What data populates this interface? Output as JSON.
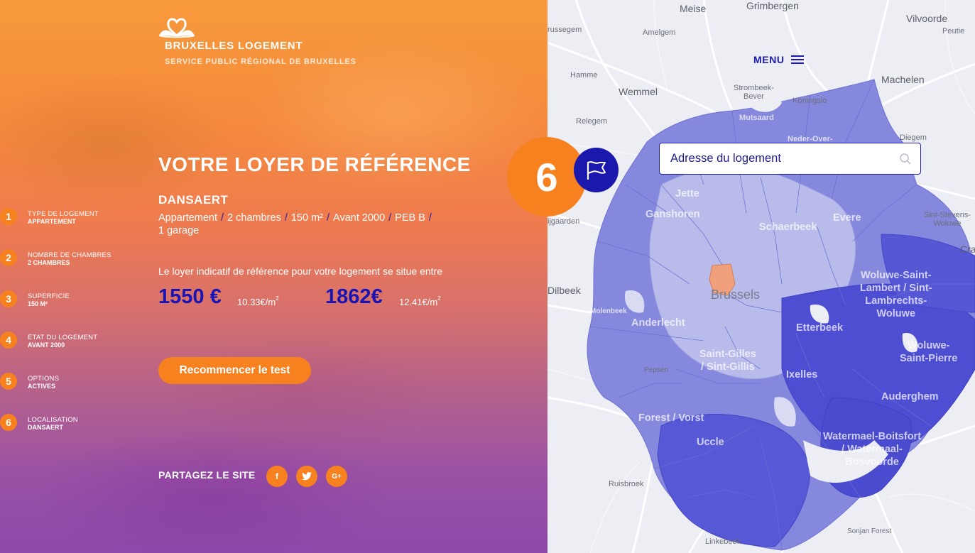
{
  "brand": {
    "title": "BRUXELLES LOGEMENT",
    "subtitle": "SERVICE PUBLIC RÉGIONAL DE BRUXELLES"
  },
  "steps": [
    {
      "num": "1",
      "label": "TYPE DE LOGEMENT",
      "value": "APPARTEMENT"
    },
    {
      "num": "2",
      "label": "NOMBRE DE CHAMBRES",
      "value": "2 CHAMBRES"
    },
    {
      "num": "3",
      "label": "SUPERFICIE",
      "value": "150 M²"
    },
    {
      "num": "4",
      "label": "ÉTAT DU LOGEMENT",
      "value": "AVANT 2000"
    },
    {
      "num": "5",
      "label": "OPTIONS",
      "value": "ACTIVES"
    },
    {
      "num": "6",
      "label": "LOCALISATION",
      "value": "DANSAERT"
    }
  ],
  "result": {
    "title": "VOTRE LOYER DE RÉFÉRENCE",
    "area": "DANSAERT",
    "specs": [
      "Appartement",
      "2 chambres",
      "150 m²",
      "Avant 2000",
      "PEB B",
      "1 garage"
    ],
    "separator": "/",
    "intro": "Le loyer indicatif de référence pour votre logement se situe entre",
    "min_price": "1550 €",
    "min_per_m2": "10.33€/m",
    "max_price": "1862€",
    "max_per_m2": "12.41€/m",
    "per_m2_exp": "2",
    "restart_label": "Recommencer le test"
  },
  "share": {
    "label": "PARTAGEZ LE SITE",
    "facebook": "f",
    "twitter": "t",
    "google": "G+"
  },
  "map": {
    "menu_label": "MENU",
    "search_placeholder": "Adresse du logement",
    "current_step": "6",
    "labels": {
      "meise": "Meise",
      "grimbergen": "Grimbergen",
      "vilvoorde": "Vilvoorde",
      "brussegem": "russegem",
      "amelgem": "Amelgem",
      "peutie": "Peutie",
      "hamme": "Hamme",
      "wemmel": "Wemmel",
      "machelen": "Machelen",
      "strombeek": "Strombeek-\nBever",
      "koningslo": "Koningslo",
      "relegem": "Relegem",
      "mutsaard": "Mutsaard",
      "neder": "Neder-Over-",
      "diegem": "Diegem",
      "jette": "Jette",
      "ganshoren": "Ganshoren",
      "schaerbeek": "Schaerbeek",
      "evere": "Evere",
      "sintstevens": "Sint-Stevens-\nWoluwe",
      "ijgaarden": "ijgaarden",
      "cra": "Cra",
      "woluwe_lambert": "Woluwe-Saint-\nLambert / Sint-\nLambrechts-\nWoluwe",
      "dilbeek": "Dilbeek",
      "brussels": "Brussels",
      "molenbeek": "Molenbeek",
      "anderlecht": "Anderlecht",
      "etterbeek": "Etterbeek",
      "woluwe_pierre": "Woluwe-\nSaint-Pierre",
      "saintgilles": "Saint-Gilles\n/ Sint-Gillis",
      "ixelles": "Ixelles",
      "pepsen": "Pepsen",
      "auderghem": "Auderghem",
      "forest": "Forest / Vorst",
      "watermael": "Watermael-Boitsfort\n/ Watermaal-\nBosvoorde",
      "uccle": "Uccle",
      "ruisbroek": "Ruisbroek",
      "sonjan": "Sonjan Forest",
      "linkebeek": "Linkebeek"
    }
  }
}
